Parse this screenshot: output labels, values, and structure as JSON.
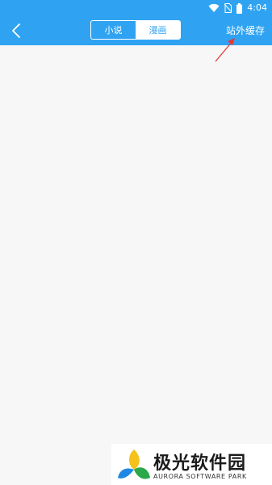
{
  "status_bar": {
    "time": "4:04",
    "icons": [
      "wifi-icon",
      "no-sim-icon",
      "battery-icon"
    ]
  },
  "nav": {
    "back_icon": "chevron-left-icon",
    "tabs": [
      {
        "label": "小说",
        "active": false
      },
      {
        "label": "漫画",
        "active": true
      }
    ],
    "offsite_cache_label": "站外缓存"
  },
  "annotation": {
    "arrow_color": "#e53935"
  },
  "watermark": {
    "title": "极光软件园",
    "subtitle": "AURORA SOFTWARE PARK"
  },
  "colors": {
    "primary": "#2fa3f2",
    "background": "#f7f7f7"
  }
}
